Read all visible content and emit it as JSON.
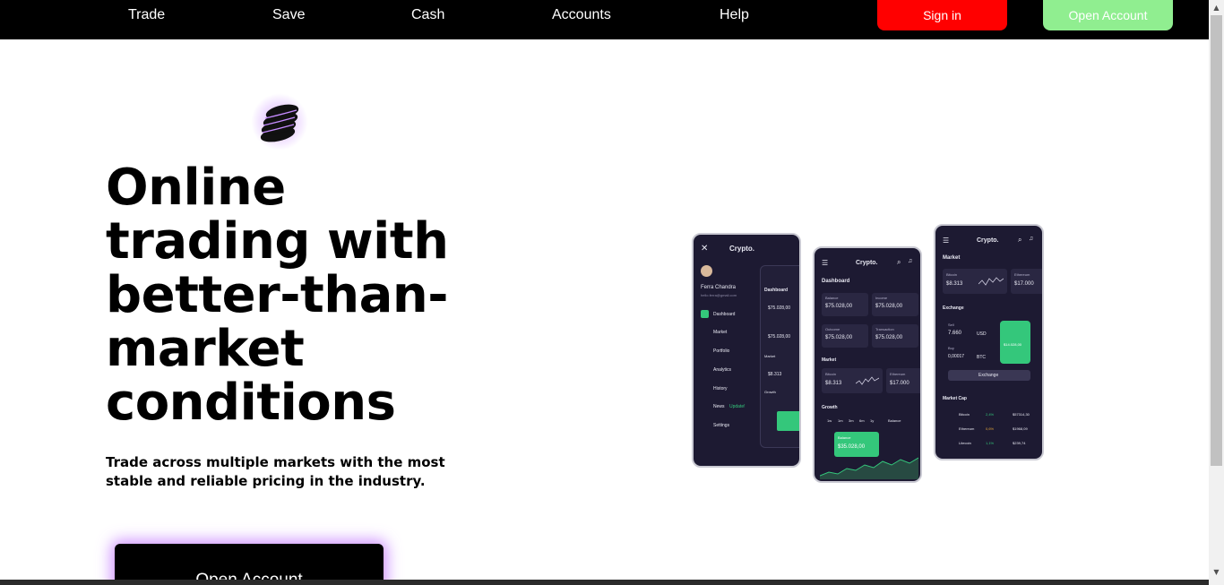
{
  "nav": {
    "links": [
      "Trade",
      "Save",
      "Cash",
      "Accounts",
      "Help"
    ],
    "sign_in": "Sign in",
    "open_account": "Open Account"
  },
  "hero": {
    "title": "Online trading with better-than-market conditions",
    "subtitle": "Trade across multiple markets with the most stable and reliable pricing in the industry.",
    "cta": "Open Account"
  },
  "mockup": {
    "brand": "Crypto.",
    "user_name": "Ferra Chandra",
    "user_email": "hello.ferra@gmail.com",
    "menu": [
      "Dashboard",
      "Market",
      "Portfolio",
      "Analytics",
      "History",
      "News",
      "Settings"
    ],
    "news_badge": "Update!",
    "dashboard": {
      "title": "Dashboard",
      "balance_label": "Balance",
      "balance_value": "$75.028,00",
      "income_label": "Income",
      "income_value": "$75.028,00",
      "outcome_label": "Outcome",
      "outcome_value": "$75.028,00",
      "transaction_label": "Transaction",
      "transaction_value": "$75.028,00",
      "market_title": "Market",
      "bitcoin_label": "Bitcoin",
      "bitcoin_value": "$8.313",
      "ethereum_label": "Ethereum",
      "ethereum_value": "$17.000",
      "growth_title": "Growth",
      "growth_periods": [
        "1w",
        "1m",
        "3m",
        "6m",
        "1y"
      ],
      "growth_select": "Balance",
      "growth_tooltip_label": "Balance",
      "growth_tooltip_value": "$35.028,00"
    },
    "market_screen": {
      "title": "Market",
      "exchange_title": "Exchange",
      "sell_label": "Sell",
      "sell_value": "7.660",
      "sell_currency": "USD",
      "buy_label": "Buy",
      "buy_value": "0,00017",
      "buy_currency": "BTC",
      "exchange_button": "Exchange",
      "card_value": "$14.028,00",
      "market_cap_title": "Market Cap",
      "market_cap": [
        {
          "name": "Bitcoin",
          "change": "2,4%",
          "price": "$57314,30"
        },
        {
          "name": "Ethereum",
          "change": "0,6%",
          "price": "$1968,09"
        },
        {
          "name": "Litecoin",
          "change": "1,1%",
          "price": "$239,74"
        }
      ]
    }
  },
  "colors": {
    "nav_bg": "#000000",
    "sign_in_bg": "#ff0000",
    "open_account_top_bg": "#90ee90",
    "cta_glow": "#be6eff",
    "phone_bg": "#1d1a32",
    "positive": "#34c77b"
  },
  "icons": [
    "coins-icon",
    "menu-icon",
    "search-icon",
    "bell-icon",
    "close-icon"
  ]
}
